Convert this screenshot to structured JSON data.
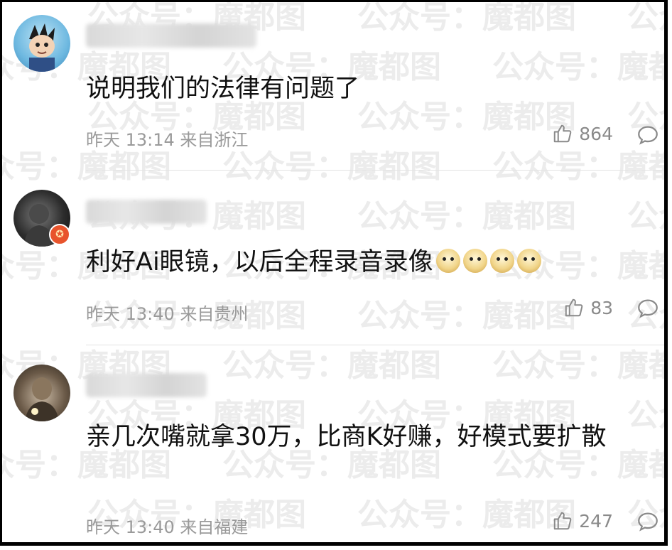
{
  "watermark": {
    "text": "公众号：魔都图"
  },
  "comments": [
    {
      "username": "",
      "text": "说明我们的法律有问题了",
      "time": "昨天 13:14 来自浙江",
      "likes": "864"
    },
    {
      "username": "",
      "text": "利好Ai眼镜，以后全程录音录像",
      "emoji_count": 4,
      "emoji_name": "doge-emoji",
      "time": "昨天 13:40 来自贵州",
      "likes": "83"
    },
    {
      "username": "",
      "text": "亲几次嘴就拿30万，比商K好赚，好模式要扩散",
      "time": "昨天 13:40 来自福建",
      "likes": "247"
    }
  ],
  "icons": {
    "like": "thumbs-up-icon",
    "reply": "comment-bubble-icon",
    "verified": "verified-badge-icon"
  },
  "colors": {
    "meta": "#9a9a9a",
    "text": "#111111",
    "badge": "#e8542c"
  }
}
